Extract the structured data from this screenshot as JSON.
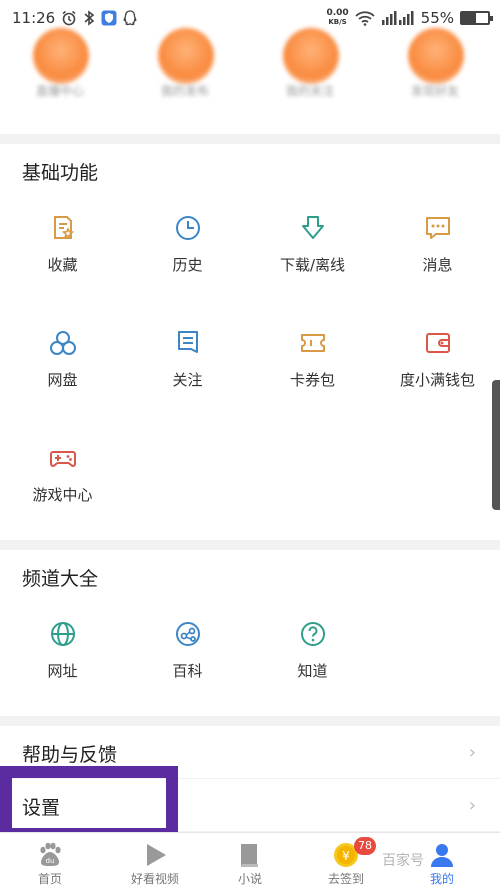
{
  "status_bar": {
    "time": "11:26",
    "net_speed_value": "0.00",
    "net_speed_unit": "KB/S",
    "battery": "55%"
  },
  "quick_links": [
    {
      "label": "直播中心"
    },
    {
      "label": "我的发布"
    },
    {
      "label": "我的关注"
    },
    {
      "label": "发现好友"
    }
  ],
  "basic": {
    "title": "基础功能",
    "items": [
      {
        "label": "收藏",
        "icon": "favorite-icon",
        "color": "#d99a45"
      },
      {
        "label": "历史",
        "icon": "clock-icon",
        "color": "#3d86c6"
      },
      {
        "label": "下载/离线",
        "icon": "download-icon",
        "color": "#2e9e8a"
      },
      {
        "label": "消息",
        "icon": "message-icon",
        "color": "#d99a45"
      },
      {
        "label": "网盘",
        "icon": "cloud-disk-icon",
        "color": "#3d86c6"
      },
      {
        "label": "关注",
        "icon": "follow-icon",
        "color": "#3d86c6"
      },
      {
        "label": "卡券包",
        "icon": "ticket-icon",
        "color": "#d99a45"
      },
      {
        "label": "度小满钱包",
        "icon": "wallet-icon",
        "color": "#d9584a"
      },
      {
        "label": "游戏中心",
        "icon": "gamepad-icon",
        "color": "#d9584a"
      }
    ]
  },
  "channels": {
    "title": "频道大全",
    "items": [
      {
        "label": "网址",
        "icon": "globe-icon",
        "color": "#2e9e8a"
      },
      {
        "label": "百科",
        "icon": "encyclopedia-icon",
        "color": "#3d86c6"
      },
      {
        "label": "知道",
        "icon": "question-icon",
        "color": "#2e9e8a"
      }
    ]
  },
  "rows": {
    "help": "帮助与反馈",
    "settings": "设置",
    "chevron": "›"
  },
  "bottom_nav": [
    {
      "label": "首页",
      "icon": "paw-icon",
      "active": false
    },
    {
      "label": "好看视频",
      "icon": "play-icon",
      "active": false
    },
    {
      "label": "小说",
      "icon": "book-icon",
      "active": false
    },
    {
      "label": "去签到",
      "icon": "coin-icon",
      "active": false,
      "badge": "78"
    },
    {
      "label": "我的",
      "icon": "profile-icon",
      "active": true
    }
  ],
  "watermark": "百家号"
}
